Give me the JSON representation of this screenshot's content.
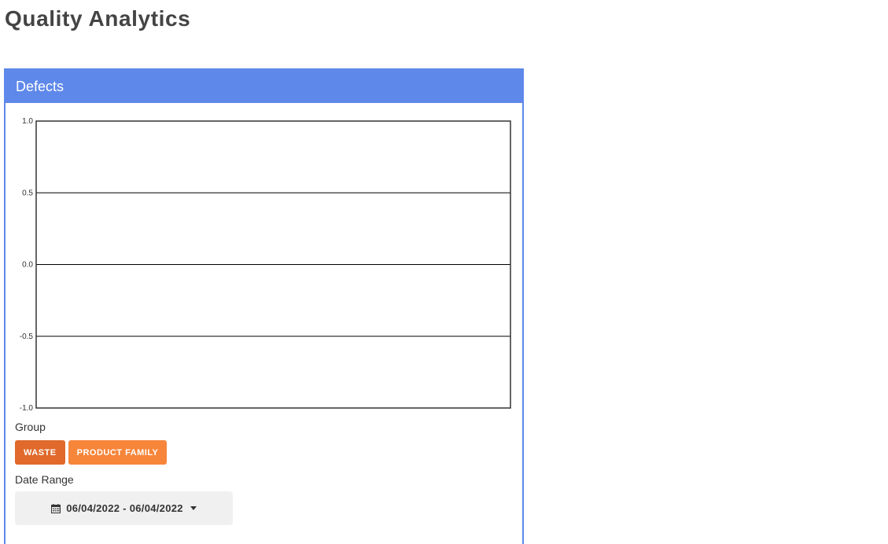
{
  "page": {
    "title": "Quality Analytics"
  },
  "card": {
    "title": "Defects"
  },
  "chart_data": {
    "type": "line",
    "title": "",
    "xlabel": "",
    "ylabel": "",
    "ylim": [
      -1.0,
      1.0
    ],
    "yticks": [
      "1.0",
      "0.5",
      "0.0",
      "-0.5",
      "-1.0"
    ],
    "series": [],
    "grid": true,
    "grid_color": "#000000"
  },
  "group": {
    "label": "Group",
    "buttons": [
      {
        "label": "WASTE",
        "color": "#e0692b"
      },
      {
        "label": "PRODUCT FAMILY",
        "color": "#f7853a"
      }
    ]
  },
  "date_range": {
    "label": "Date Range",
    "value": "06/04/2022 - 06/04/2022",
    "icon": "calendar-icon"
  },
  "colors": {
    "accent": "#5e88ea"
  }
}
